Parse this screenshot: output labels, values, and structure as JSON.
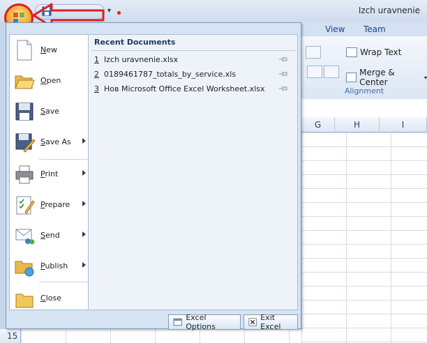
{
  "window": {
    "title": "Izch uravnenie"
  },
  "ribbon": {
    "tabs": [
      "View",
      "Team"
    ],
    "wrap_text": "Wrap Text",
    "merge_center": "Merge & Center",
    "group_label": "Alignment"
  },
  "sheet": {
    "columns": [
      "G",
      "H",
      "I"
    ],
    "row_label": "15"
  },
  "menu": {
    "items": [
      {
        "label": "New",
        "icon": "new-document-icon",
        "submenu": false
      },
      {
        "label": "Open",
        "icon": "open-folder-icon",
        "submenu": false
      },
      {
        "label": "Save",
        "icon": "save-disk-icon",
        "submenu": false
      },
      {
        "label": "Save As",
        "icon": "save-as-icon",
        "submenu": true
      },
      {
        "label": "Print",
        "icon": "printer-icon",
        "submenu": true
      },
      {
        "label": "Prepare",
        "icon": "prepare-icon",
        "submenu": true
      },
      {
        "label": "Send",
        "icon": "send-icon",
        "submenu": true
      },
      {
        "label": "Publish",
        "icon": "publish-icon",
        "submenu": true
      },
      {
        "label": "Close",
        "icon": "close-folder-icon",
        "submenu": false
      }
    ],
    "recent_title": "Recent Documents",
    "recent": [
      {
        "num": "1",
        "name": "Izch uravnenie.xlsx"
      },
      {
        "num": "2",
        "name": "0189461787_totals_by_service.xls"
      },
      {
        "num": "3",
        "name": "Нов Microsoft Office Excel Worksheet.xlsx"
      }
    ],
    "options_label": "Excel Options",
    "exit_label": "Exit Excel"
  },
  "colors": {
    "annotation": "#e01f1f",
    "ribbon_text": "#15428b"
  }
}
